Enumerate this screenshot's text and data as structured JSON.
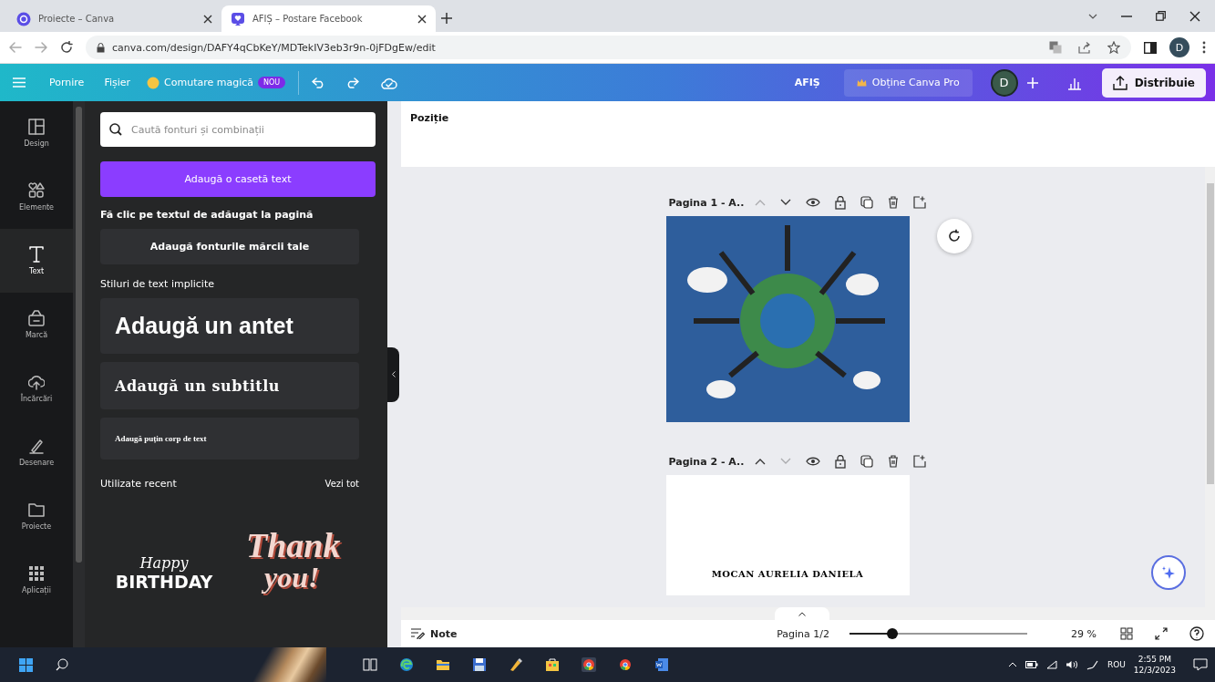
{
  "browser": {
    "tabs": [
      {
        "title": "Proiecte – Canva",
        "selected": false
      },
      {
        "title": "AFIȘ – Postare Facebook",
        "selected": true
      }
    ],
    "url": "canva.com/design/DAFY4qCbKeY/MDTekIV3eb3r9n-0jFDgEw/edit",
    "profile": "D"
  },
  "toolbar": {
    "menu": [
      "Pornire",
      "Fișier"
    ],
    "magic": "Comutare magică",
    "magic_badge": "NOU",
    "title": "AFIȘ",
    "pro": "Obține Canva Pro",
    "avatar": "D",
    "share": "Distribuie"
  },
  "rail": [
    {
      "label": "Design",
      "selected": false
    },
    {
      "label": "Elemente",
      "selected": false
    },
    {
      "label": "Text",
      "selected": true
    },
    {
      "label": "Marcă",
      "selected": false
    },
    {
      "label": "Încărcări",
      "selected": false
    },
    {
      "label": "Desenare",
      "selected": false
    },
    {
      "label": "Proiecte",
      "selected": false
    },
    {
      "label": "Aplicații",
      "selected": false
    }
  ],
  "panel": {
    "search_placeholder": "Caută fonturi și combinații",
    "add_button": "Adaugă o casetă text",
    "hint": "Fă clic pe textul de adăugat la pagină",
    "brand_button": "Adaugă fonturile mărcii tale",
    "styles_heading": "Stiluri de text implicite",
    "styles": [
      {
        "kind": "heading",
        "text": "Adaugă un antet"
      },
      {
        "kind": "subheading",
        "text": "Adaugă un subtitlu"
      },
      {
        "kind": "body",
        "text": "Adaugă puțin corp de text"
      }
    ],
    "recent_heading": "Utilizate recent",
    "see_all": "Vezi tot",
    "recent": [
      {
        "kind": "birthday",
        "lines": [
          "Happy",
          "BIRTHDAY"
        ]
      },
      {
        "kind": "thanks",
        "lines": [
          "Thank",
          "you!"
        ]
      }
    ]
  },
  "editor": {
    "header": "Poziție",
    "pages": [
      {
        "title": "Pagina 1 - A..",
        "kind": "poster",
        "up_disabled": true,
        "down_disabled": false
      },
      {
        "title": "Pagina 2 - A..",
        "kind": "text",
        "text": "MOCAN AURELIA DANIELA",
        "up_disabled": false,
        "down_disabled": true
      }
    ]
  },
  "footer": {
    "notes": "Note",
    "page": "Pagina 1/2",
    "zoom": {
      "level": 0.27
    },
    "zoom_reading": "29 %"
  },
  "taskbar": {
    "language": "ROU",
    "time": "2:55 PM",
    "date": "12/3/2023"
  }
}
